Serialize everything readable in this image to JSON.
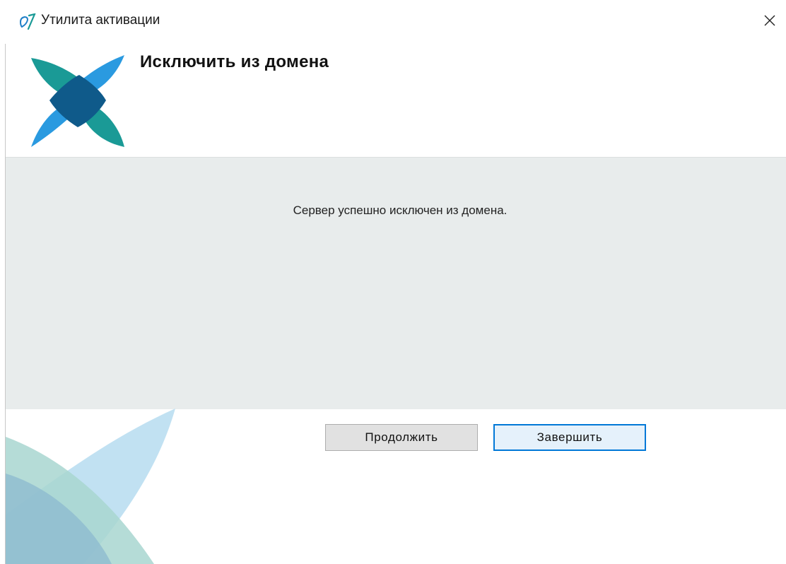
{
  "window": {
    "title": "Утилита активации",
    "close_glyph": "✕"
  },
  "icons": {
    "app": "activation-utility-icon",
    "close": "close-icon",
    "logo": "petal-logo-icon",
    "decoration": "petal-decoration-icon"
  },
  "page": {
    "title": "Исключить из домена"
  },
  "content": {
    "message": "Сервер успешно исключен из домена."
  },
  "buttons": {
    "continue_label": "Продолжить",
    "finish_label": "Завершить"
  },
  "colors": {
    "content_bg": "#e8ecec",
    "accent": "#0078d7",
    "logo_teal": "#1a9a96",
    "logo_blue": "#2a8fd8",
    "logo_navy": "#0f5a8a"
  }
}
